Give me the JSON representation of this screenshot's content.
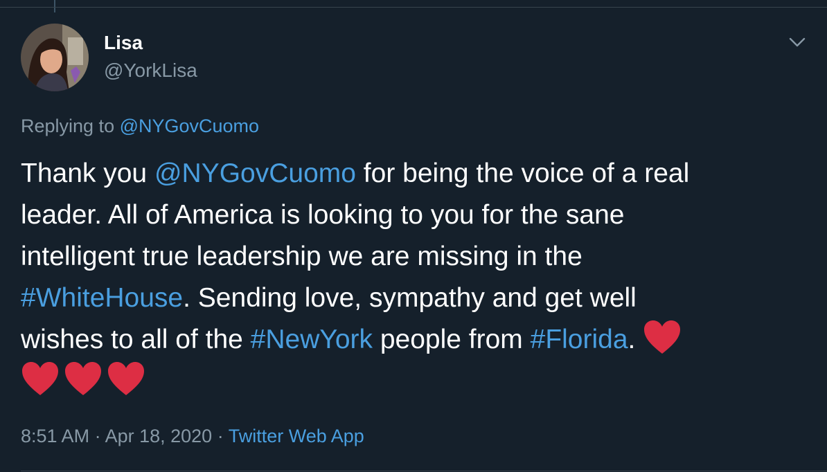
{
  "author": {
    "name": "Lisa",
    "handle": "@YorkLisa"
  },
  "reply": {
    "prefix": "Replying to ",
    "mention": "@NYGovCuomo"
  },
  "tweet": {
    "line1_a": "Thank you ",
    "line1_mention": "@NYGovCuomo",
    "line1_b": " for being the voice of a real",
    "line2": "leader. All of America is looking to you for the sane",
    "line3": "intelligent true leadership we are missing in the",
    "line4_hashtag": "#WhiteHouse",
    "line4_b": ". Sending love, sympathy and get well",
    "line5_a": "wishes to all of the ",
    "line5_hashtag1": "#NewYork",
    "line5_b": " people from ",
    "line5_hashtag2": "#Florida",
    "line5_c": ". ",
    "emoji": "red-heart",
    "heart_count": 4
  },
  "meta": {
    "time": "8:51 AM",
    "sep1": " · ",
    "date": "Apr 18, 2020",
    "sep2": " · ",
    "source": "Twitter Web App"
  },
  "colors": {
    "background": "#15202b",
    "link": "#4a9fe0",
    "secondary_text": "#8899a6",
    "heart": "#dd2e44"
  },
  "icons": {
    "menu": "chevron-down-icon",
    "emoji": "red-heart-icon"
  }
}
